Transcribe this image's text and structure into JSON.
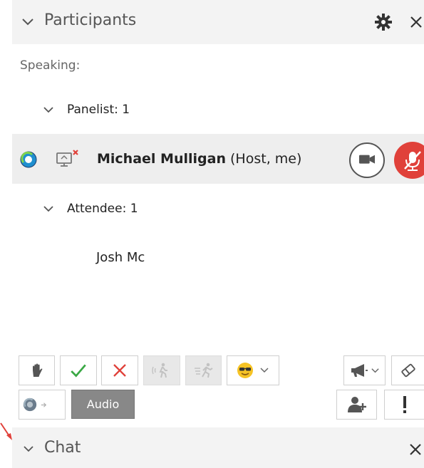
{
  "participants_panel": {
    "title": "Participants",
    "speaking_label": "Speaking:",
    "panelist_group_label": "Panelist: 1",
    "attendee_group_label": "Attendee: 1",
    "host": {
      "name": "Michael Mulligan",
      "role_suffix": "(Host, me)"
    },
    "attendees": [
      "Josh Mc"
    ]
  },
  "toolbar": {
    "audio_label": "Audio",
    "icons": [
      "raise-hand-icon",
      "checkmark-icon",
      "x-mark-icon",
      "go-slower-icon",
      "go-faster-icon",
      "emoji-sunglasses-icon",
      "megaphone-icon",
      "eraser-icon",
      "add-person-icon",
      "alert-icon"
    ]
  },
  "chat_panel": {
    "title": "Chat"
  },
  "colors": {
    "mute_red": "#e0413a",
    "approve_green": "#3aa845",
    "reject_red": "#e0413a",
    "status_blue": "#1f8fcf"
  }
}
